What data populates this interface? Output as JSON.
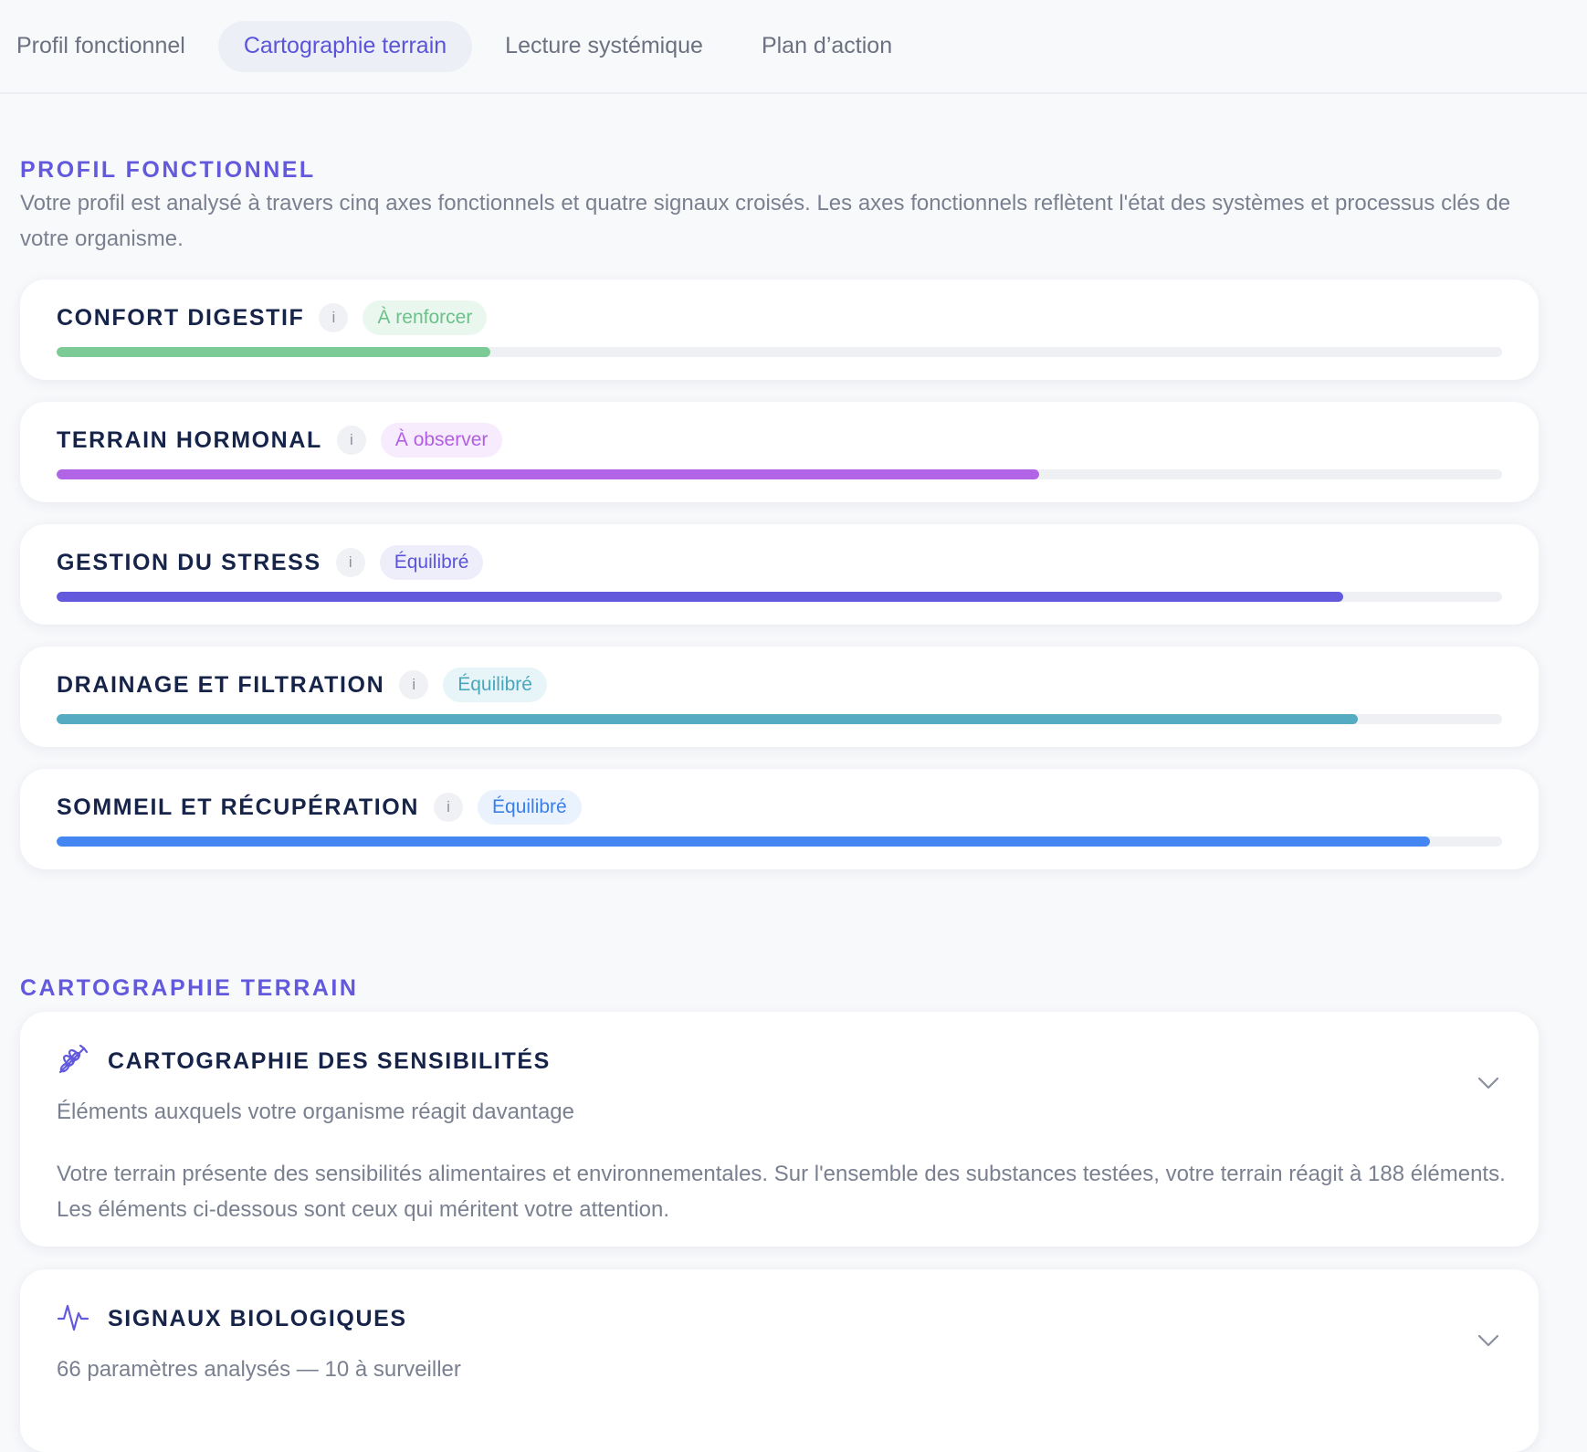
{
  "tabs": [
    {
      "label": "Profil fonctionnel"
    },
    {
      "label": "Cartographie terrain"
    },
    {
      "label": "Lecture systémique"
    },
    {
      "label": "Plan d’action"
    }
  ],
  "active_tab": "Cartographie terrain",
  "profil": {
    "heading": "PROFIL FONCTIONNEL",
    "intro": "Votre profil est analysé à travers cinq axes fonctionnels et quatre signaux croisés. Les axes fonctionnels reflètent l'état des systèmes et processus clés de votre organisme.",
    "info_symbol": "i",
    "axes": [
      {
        "title": "CONFORT DIGESTIF",
        "status": "À renforcer",
        "level_percent": 30,
        "color": "#7ccb96",
        "badge_bg": "#eaf7ef",
        "badge_color": "#6cc08a"
      },
      {
        "title": "TERRAIN HORMONAL",
        "status": "À observer",
        "level_percent": 68,
        "color": "#b165e6",
        "badge_bg": "#f7ecfd",
        "badge_color": "#b15ee3"
      },
      {
        "title": "GESTION DU STRESS",
        "status": "Équilibré",
        "level_percent": 89,
        "color": "#6259dd",
        "badge_bg": "#eeeefb",
        "badge_color": "#5b54d8"
      },
      {
        "title": "DRAINAGE ET FILTRATION",
        "status": "Équilibré",
        "level_percent": 90,
        "color": "#54abc2",
        "badge_bg": "#e8f5f8",
        "badge_color": "#4aa6bd"
      },
      {
        "title": "SOMMEIL ET RÉCUPÉRATION",
        "status": "Équilibré",
        "level_percent": 95,
        "color": "#4487f2",
        "badge_bg": "#eaf2fe",
        "badge_color": "#3b7fe8"
      }
    ]
  },
  "cartographie": {
    "heading": "CARTOGRAPHIE TERRAIN",
    "sensibilites": {
      "title": "CARTOGRAPHIE DES SENSIBILITÉS",
      "subtitle": "Éléments auxquels votre organisme réagit davantage",
      "body": "Votre terrain présente des sensibilités alimentaires et environnementales. Sur l'ensemble des substances testées, votre terrain réagit à 188 éléments. Les éléments ci-dessous sont ceux qui méritent votre attention.",
      "icon": "wheat-icon"
    },
    "signaux": {
      "title": "SIGNAUX BIOLOGIQUES",
      "subtitle": "66 paramètres analysés — 10 à surveiller",
      "icon": "pulse-icon"
    }
  },
  "accent_color": "#6259dd"
}
